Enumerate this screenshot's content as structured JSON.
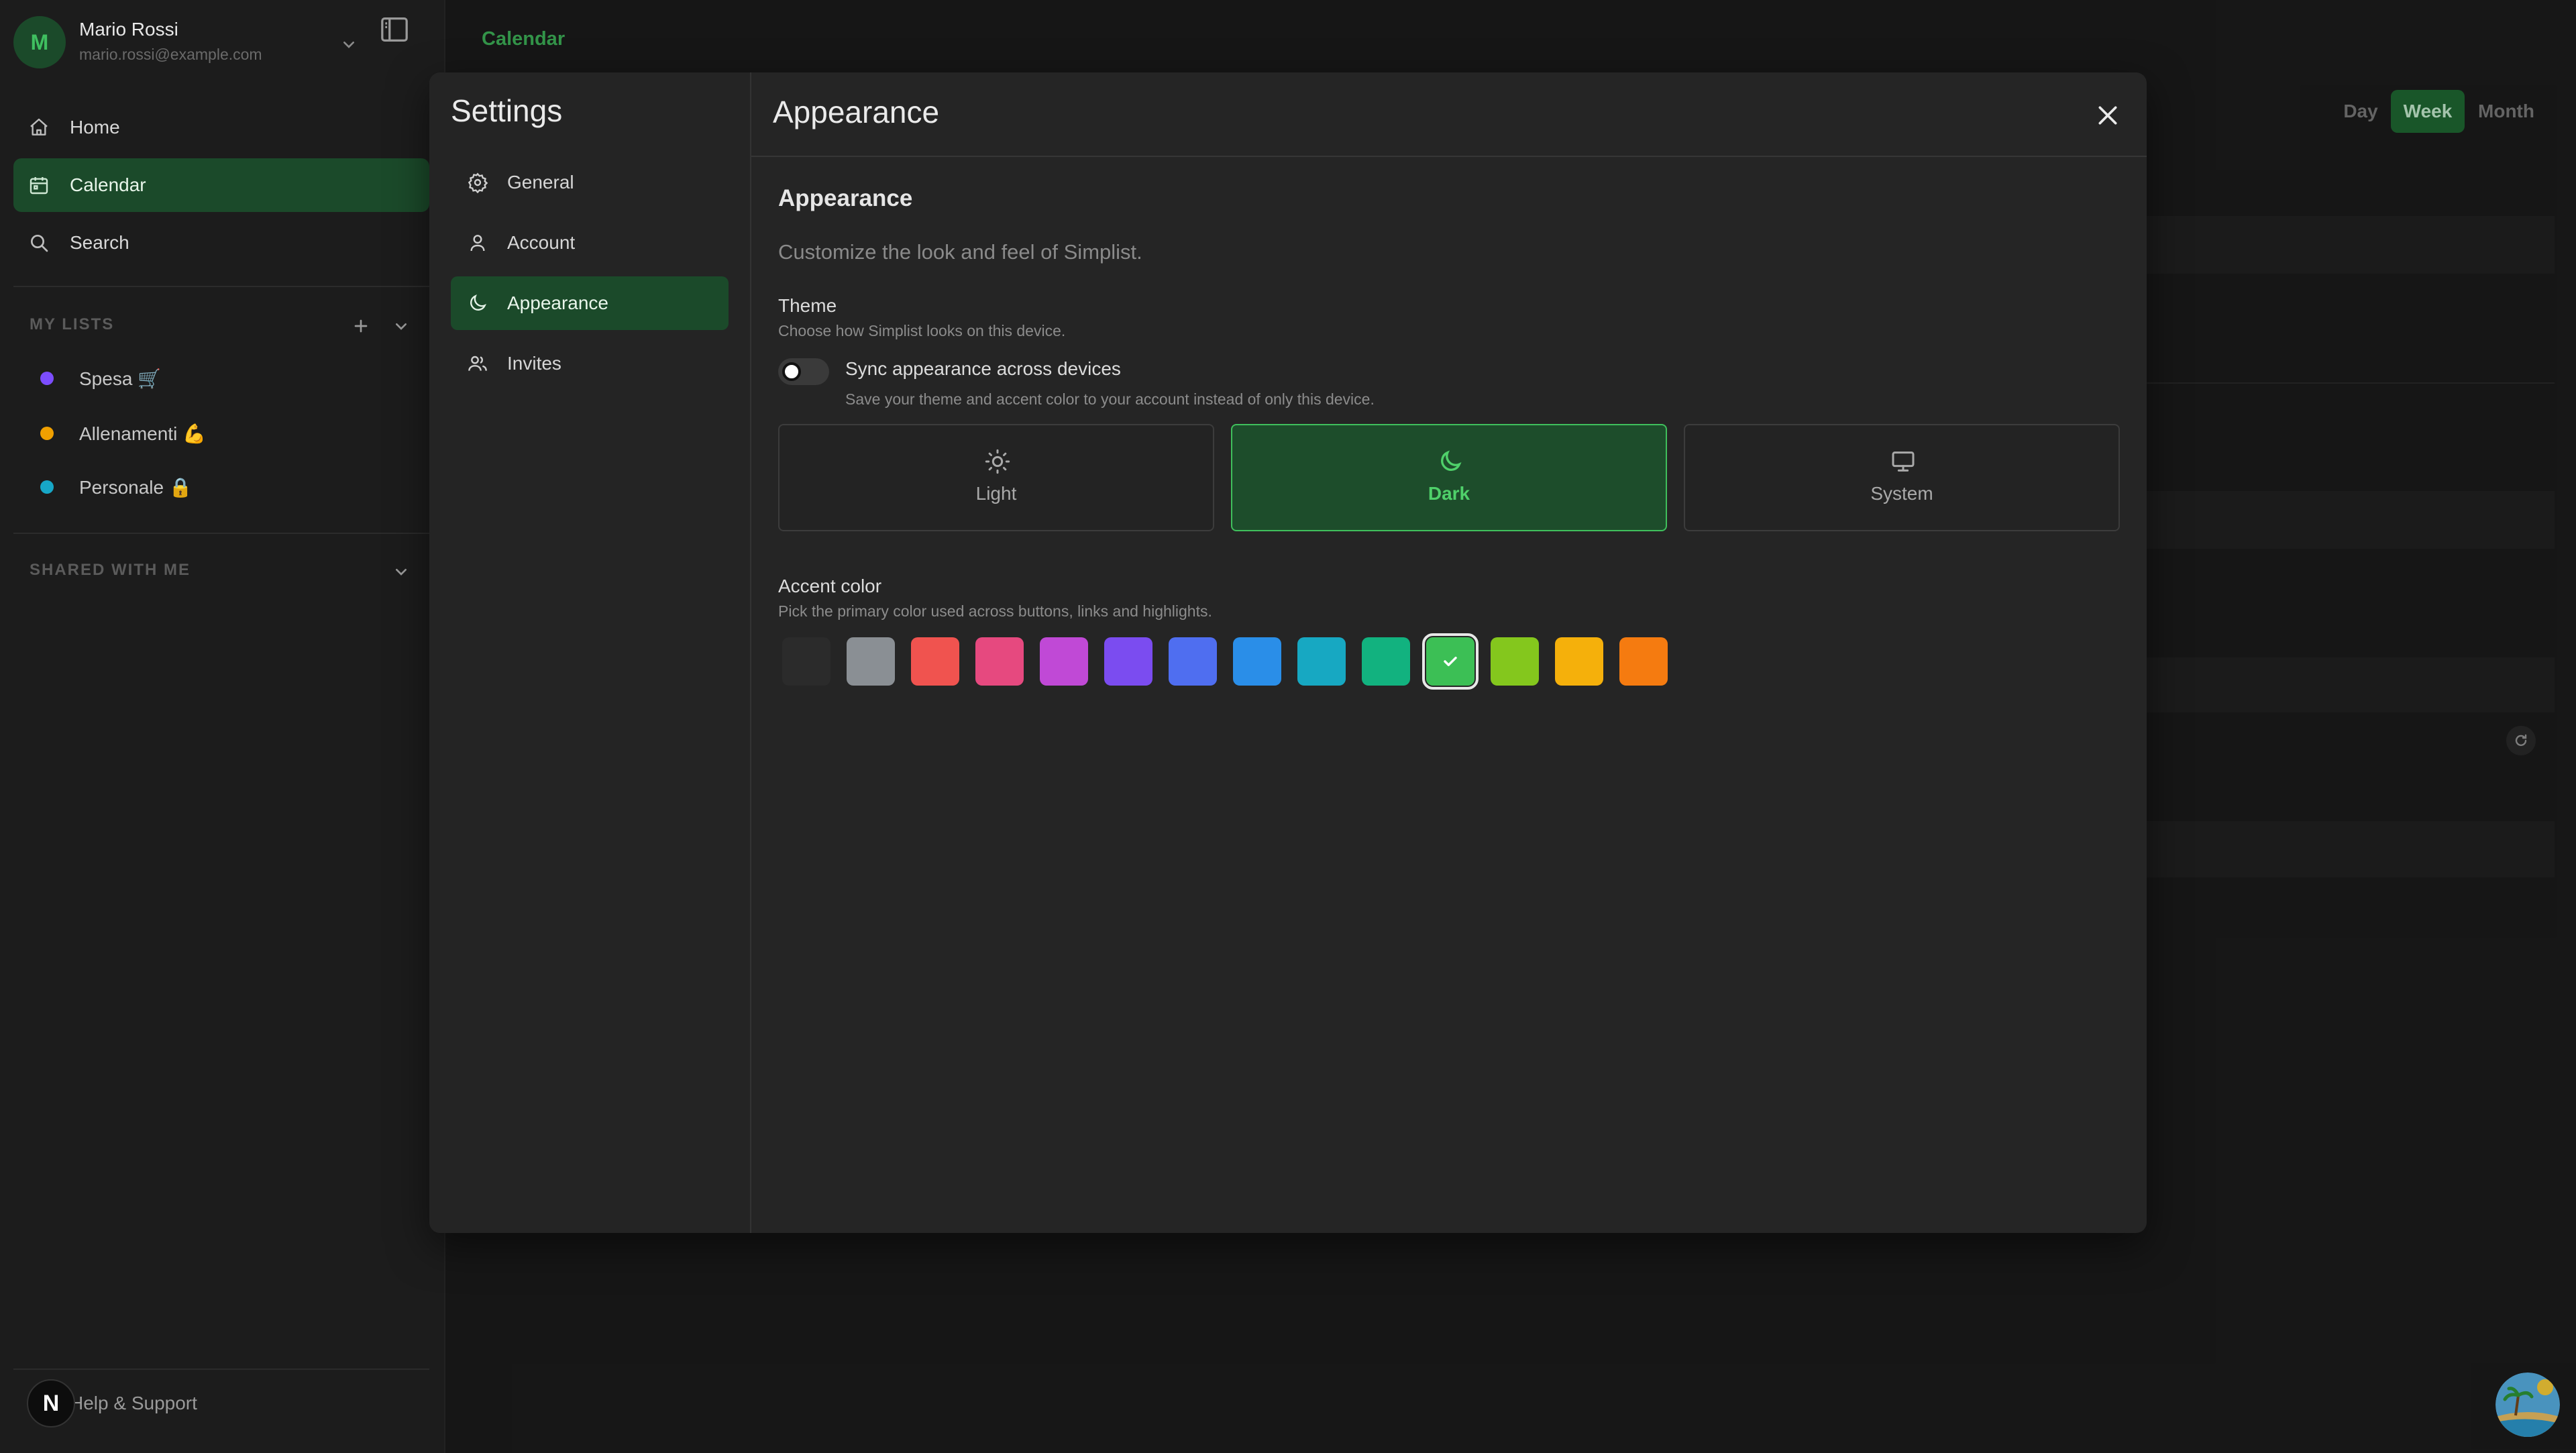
{
  "user": {
    "initial": "M",
    "name": "Mario Rossi",
    "email": "mario.rossi@example.com"
  },
  "nav": [
    {
      "label": "Home",
      "icon": "home-icon"
    },
    {
      "label": "Calendar",
      "icon": "calendar-icon",
      "active": true
    },
    {
      "label": "Search",
      "icon": "search-icon"
    }
  ],
  "my_lists": {
    "title": "MY LISTS",
    "items": [
      {
        "label": "Spesa 🛒",
        "color": "#7c4dff"
      },
      {
        "label": "Allenamenti 💪",
        "color": "#f0a000"
      },
      {
        "label": "Personale 🔒",
        "color": "#17a7c7"
      }
    ]
  },
  "shared": {
    "title": "SHARED WITH ME"
  },
  "help": {
    "badge": "N",
    "label": "Help & Support"
  },
  "main": {
    "title": "Calendar",
    "views": [
      "Day",
      "Week",
      "Month"
    ],
    "active_view": "Week"
  },
  "settings": {
    "title": "Settings",
    "nav": [
      {
        "label": "General",
        "icon": "gear-icon"
      },
      {
        "label": "Account",
        "icon": "user-icon"
      },
      {
        "label": "Appearance",
        "icon": "moon-icon",
        "active": true
      },
      {
        "label": "Invites",
        "icon": "users-icon"
      }
    ],
    "header": "Appearance",
    "section_title": "Appearance",
    "section_desc": "Customize the look and feel of Simplist.",
    "theme_label": "Theme",
    "theme_desc": "Choose how Simplist looks on this device.",
    "sync_label": "Sync appearance across devices",
    "sync_desc": "Save your theme and accent color to your account instead of only this device.",
    "sync_enabled": false,
    "themes": [
      {
        "label": "Light",
        "icon": "sun-icon"
      },
      {
        "label": "Dark",
        "icon": "moon-icon",
        "active": true
      },
      {
        "label": "System",
        "icon": "monitor-icon"
      }
    ],
    "accent_label": "Accent color",
    "accent_desc": "Pick the primary color used across buttons, links and highlights.",
    "accent_colors": [
      "#2b2b2b",
      "#8a8f94",
      "#f0534f",
      "#e6497f",
      "#c049d6",
      "#7b4cf0",
      "#4f6ef0",
      "#2a8ee8",
      "#17a8c2",
      "#12b27f",
      "#3cbf55",
      "#84c71d",
      "#f5b00b",
      "#f57b10"
    ],
    "selected_accent": "#3cbf55"
  }
}
